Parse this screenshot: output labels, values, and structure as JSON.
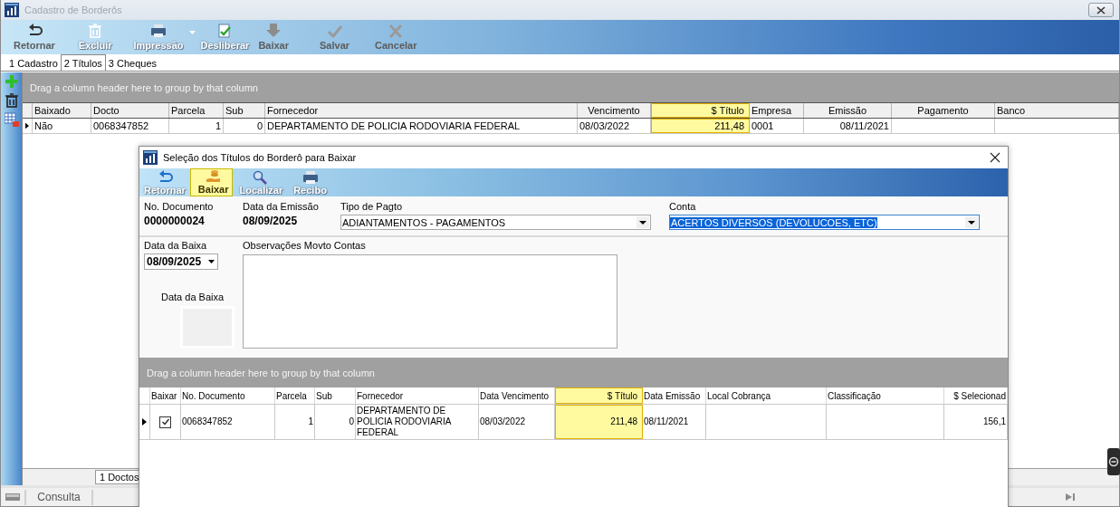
{
  "window": {
    "title": "Cadastro de Borderôs"
  },
  "toolbar": [
    {
      "label": "Retornar",
      "disabled": false,
      "has_menu": false
    },
    {
      "label": "Excluir",
      "disabled": true,
      "has_menu": false
    },
    {
      "label": "Impressão",
      "disabled": true,
      "has_menu": true
    },
    {
      "label": "Desliberar",
      "disabled": true,
      "has_menu": false
    },
    {
      "label": "Baixar",
      "disabled": false,
      "has_menu": false
    },
    {
      "label": "Salvar",
      "disabled": false,
      "has_menu": false
    },
    {
      "label": "Cancelar",
      "disabled": false,
      "has_menu": false
    }
  ],
  "tabs": [
    {
      "label": "1 Cadastro",
      "selected": false
    },
    {
      "label": "2 Títulos",
      "selected": true
    },
    {
      "label": "3 Cheques",
      "selected": false
    }
  ],
  "grid": {
    "group_hint": "Drag a column header here to group by that column",
    "columns": [
      {
        "label": "Baixado",
        "highlighted": false
      },
      {
        "label": "Docto",
        "highlighted": false
      },
      {
        "label": "Parcela",
        "highlighted": false
      },
      {
        "label": "Sub",
        "highlighted": false
      },
      {
        "label": "Fornecedor",
        "highlighted": false
      },
      {
        "label": "Vencimento",
        "highlighted": false
      },
      {
        "label": "$ Título",
        "highlighted": true
      },
      {
        "label": "Empresa",
        "highlighted": false
      },
      {
        "label": "Emissão",
        "highlighted": false
      },
      {
        "label": "Pagamento",
        "highlighted": false
      },
      {
        "label": "Banco",
        "highlighted": false
      }
    ],
    "rows": [
      {
        "current": true,
        "cells": [
          "Não",
          "0068347852",
          "1",
          "0",
          "DEPARTAMENTO DE POLICIA RODOVIARIA FEDERAL",
          "08/03/2022",
          "211,48",
          "0001",
          "08/11/2021",
          "",
          ""
        ]
      }
    ]
  },
  "status": {
    "count": "1 Doctos"
  },
  "bottom_bar": {
    "mode": "Consulta"
  },
  "dialog": {
    "title": "Seleção dos Títulos do Borderô para Baixar",
    "toolbar": [
      {
        "label": "Retornar",
        "disabled": true,
        "highlighted": false
      },
      {
        "label": "Baixar",
        "disabled": false,
        "highlighted": true
      },
      {
        "label": "Localizar",
        "disabled": true,
        "highlighted": false
      },
      {
        "label": "Recibo",
        "disabled": true,
        "highlighted": false
      }
    ],
    "document_number": {
      "label": "No. Documento",
      "value": "0000000024"
    },
    "issue_date": {
      "label": "Data da Emissão",
      "value": "08/09/2025"
    },
    "payment_type": {
      "label": "Tipo de Pagto",
      "value": "ADIANTAMENTOS - PAGAMENTOS",
      "focused": false
    },
    "account": {
      "label": "Conta",
      "value": "ACERTOS DIVERSOS (DEVOLUCOES, ETC)",
      "focused": true
    },
    "settle_date": {
      "label": "Data da Baixa",
      "value": "08/09/2025"
    },
    "notes": {
      "label": "Observações Movto Contas"
    },
    "settle_image": {
      "label": "Data da Baixa"
    },
    "grid": {
      "group_hint": "Drag a column header here to group by that column",
      "columns": [
        {
          "label": "Baixar",
          "highlighted": false
        },
        {
          "label": "No. Documento",
          "highlighted": false
        },
        {
          "label": "Parcela",
          "highlighted": false
        },
        {
          "label": "Sub",
          "highlighted": false
        },
        {
          "label": "Fornecedor",
          "highlighted": false
        },
        {
          "label": "Data Vencimento",
          "highlighted": false
        },
        {
          "label": "$ Título",
          "highlighted": true
        },
        {
          "label": "Data Emissão",
          "highlighted": false
        },
        {
          "label": "Local Cobrança",
          "highlighted": false
        },
        {
          "label": "Classificação",
          "highlighted": false
        },
        {
          "label": "$ Selecionad",
          "highlighted": false
        }
      ],
      "rows": [
        {
          "current": true,
          "checked": true,
          "cells": [
            "",
            "0068347852",
            "1",
            "0",
            "DEPARTAMENTO DE POLICIA RODOVIARIA FEDERAL",
            "08/03/2022",
            "211,48",
            "08/11/2021",
            "",
            "",
            "156,1"
          ]
        }
      ]
    }
  }
}
